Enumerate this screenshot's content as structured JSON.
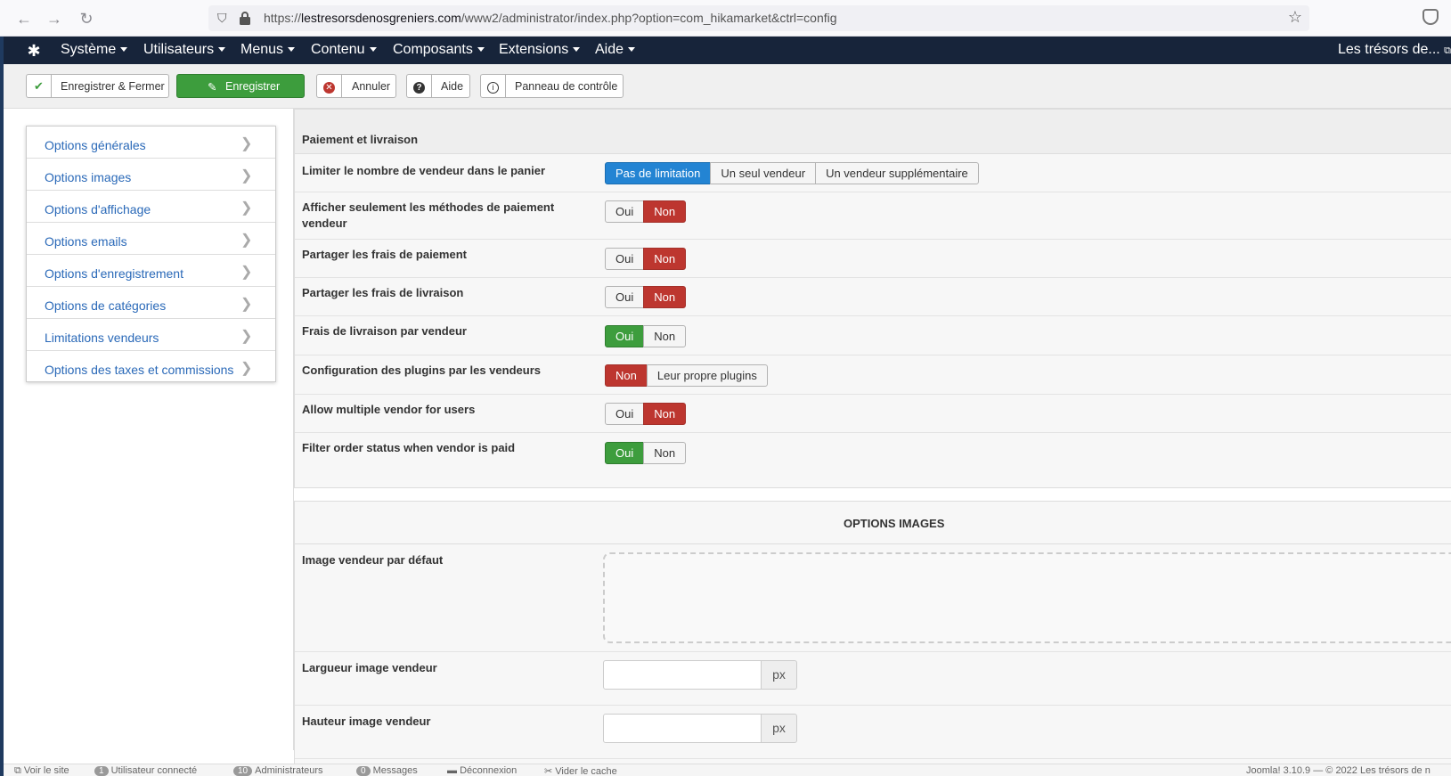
{
  "browser": {
    "url_prefix": "https://",
    "url_domain": "lestresorsdenosgreniers.com",
    "url_path": "/www2/administrator/index.php?option=com_hikamarket&ctrl=config"
  },
  "topnav": {
    "menus": [
      "Système",
      "Utilisateurs",
      "Menus",
      "Contenu",
      "Composants",
      "Extensions",
      "Aide"
    ],
    "site_link": "Les trésors de..."
  },
  "toolbar": {
    "save_close": "Enregistrer & Fermer",
    "save": "Enregistrer",
    "cancel": "Annuler",
    "help": "Aide",
    "control_panel": "Panneau de contrôle"
  },
  "sidebar": {
    "items": [
      {
        "label": "Options générales"
      },
      {
        "label": "Options images"
      },
      {
        "label": "Options d'affichage"
      },
      {
        "label": "Options emails"
      },
      {
        "label": "Options d'enregistrement"
      },
      {
        "label": "Options de catégories"
      },
      {
        "label": "Limitations vendeurs"
      },
      {
        "label": "Options des taxes et commissions"
      }
    ]
  },
  "payment": {
    "legend": "Paiement et livraison",
    "rows": [
      {
        "label": "Limiter le nombre de vendeur dans le panier",
        "options": [
          "Pas de limitation",
          "Un seul vendeur",
          "Un vendeur supplémentaire"
        ],
        "selected": "Pas de limitation"
      },
      {
        "label": "Afficher seulement les méthodes de paiement vendeur",
        "options": [
          "Oui",
          "Non"
        ],
        "selected": "Non"
      },
      {
        "label": "Partager les frais de paiement",
        "options": [
          "Oui",
          "Non"
        ],
        "selected": "Non"
      },
      {
        "label": "Partager les frais de livraison",
        "options": [
          "Oui",
          "Non"
        ],
        "selected": "Non"
      },
      {
        "label": "Frais de livraison par vendeur",
        "options": [
          "Oui",
          "Non"
        ],
        "selected": "Oui"
      },
      {
        "label": "Configuration des plugins par les vendeurs",
        "options": [
          "Non",
          "Leur propre plugins"
        ],
        "selected": "Non"
      },
      {
        "label": "Allow multiple vendor for users",
        "options": [
          "Oui",
          "Non"
        ],
        "selected": "Non"
      },
      {
        "label": "Filter order status when vendor is paid",
        "options": [
          "Oui",
          "Non"
        ],
        "selected": "Oui"
      }
    ]
  },
  "images": {
    "title": "OPTIONS IMAGES",
    "default_image_label": "Image vendeur par défaut",
    "width_label": "Largueur image vendeur",
    "height_label": "Hauteur image vendeur",
    "unit": "px"
  },
  "statusbar": {
    "view_site": "Voir le site",
    "users_count": "1",
    "users_label": "Utilisateur connecté",
    "admins_count": "10",
    "admins_label": "Administrateurs",
    "messages_count": "0",
    "messages_label": "Messages",
    "logout": "Déconnexion",
    "clear_cache": "Vider le cache",
    "version": "Joomla! 3.10.9",
    "copyright": "© 2022 Les trésors de n"
  },
  "colors": {
    "blue": "#2384d3",
    "red": "#bd362f",
    "green": "#3d9d3d",
    "nav": "#17243a"
  }
}
